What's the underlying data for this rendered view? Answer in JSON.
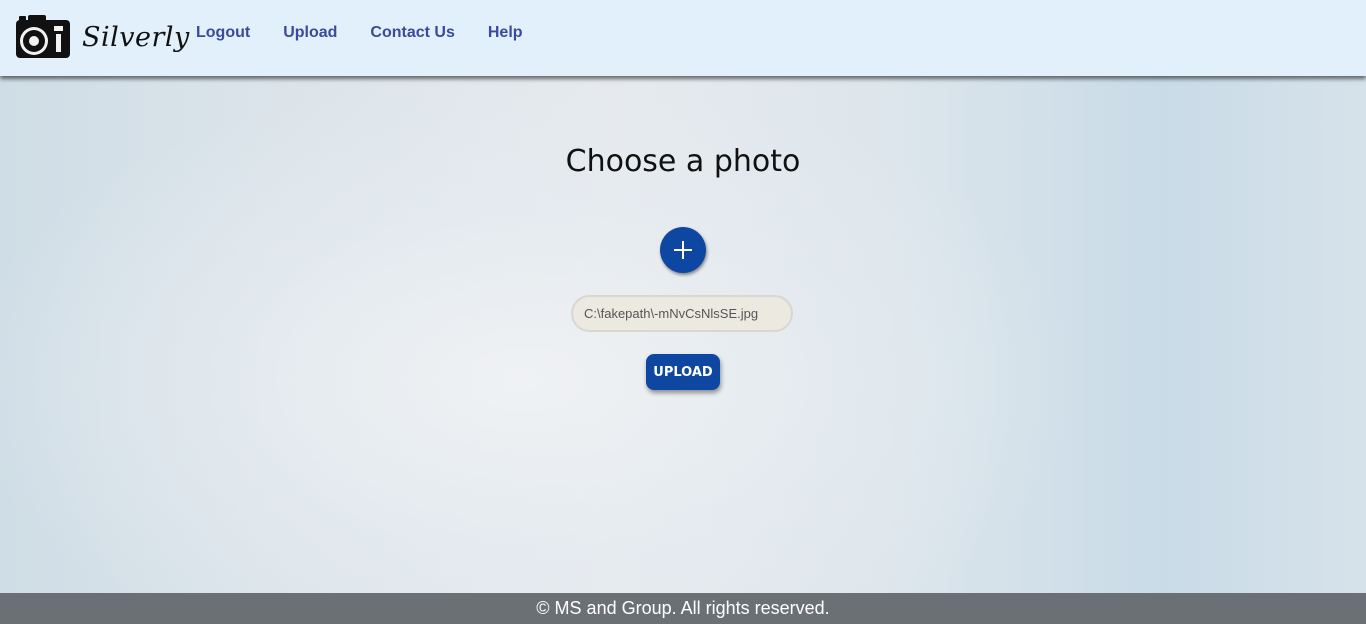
{
  "navbar": {
    "brand_name": "Silverly",
    "logo_icon": "camera-icon",
    "links": [
      {
        "label": "Logout"
      },
      {
        "label": "Upload"
      },
      {
        "label": "Contact Us"
      },
      {
        "label": "Help"
      }
    ]
  },
  "main": {
    "title": "Choose a photo",
    "add_button_icon": "plus-icon",
    "file_field_value": "C:\\fakepath\\-mNvCsNlsSE.jpg",
    "upload_button_label": "UPLOAD"
  },
  "footer": {
    "text": "© MS and Group. All rights reserved."
  },
  "colors": {
    "navbar_bg": "#e2f0fb",
    "nav_link": "#3a4a9c",
    "accent": "#0d47a1",
    "footer_bg": "#6b7075"
  }
}
